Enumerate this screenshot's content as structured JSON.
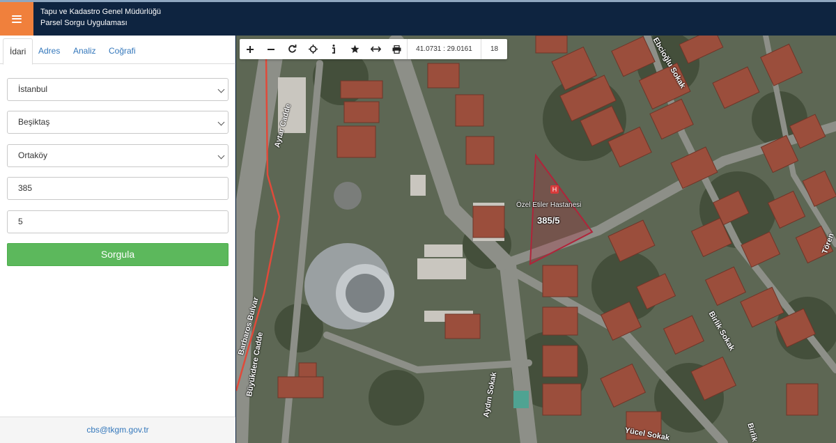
{
  "header": {
    "menu_icon": "hamburger-icon",
    "title_line1": "Tapu ve Kadastro Genel Müdürlüğü",
    "title_line2": "Parsel Sorgu Uygulaması"
  },
  "sidebar": {
    "tabs": [
      {
        "label": "İdari",
        "active": true
      },
      {
        "label": "Adres",
        "active": false
      },
      {
        "label": "Analiz",
        "active": false
      },
      {
        "label": "Coğrafi",
        "active": false
      }
    ],
    "province": "İstanbul",
    "district": "Beşiktaş",
    "neighborhood": "Ortaköy",
    "block": "385",
    "parcel": "5",
    "query_button": "Sorgula",
    "footer_email": "cbs@tkgm.gov.tr"
  },
  "toolbar": {
    "tools": [
      "zoom-in-icon",
      "zoom-out-icon",
      "refresh-icon",
      "pan-icon",
      "info-icon",
      "star-icon",
      "measure-icon",
      "print-icon"
    ],
    "coordinates": "41.0731 : 29.0161",
    "zoom_level": "18"
  },
  "map": {
    "parcel_label": "385/5",
    "poi_label": "Özel Etiler Hastanesi",
    "streets": [
      "Aytar Cadde",
      "Barbaros Bulvar",
      "Büyükdere Cadde",
      "Aydın Sokak",
      "Ebcioğlu Sokak",
      "Birlik Sokak",
      "Yücel Sokak",
      "Birlik",
      "Tören"
    ],
    "colors": {
      "parcel_outline": "#b0243a",
      "route": "#e04a3a",
      "accent": "#f0803c",
      "header": "#0e2440",
      "button": "#5cb85c"
    }
  }
}
